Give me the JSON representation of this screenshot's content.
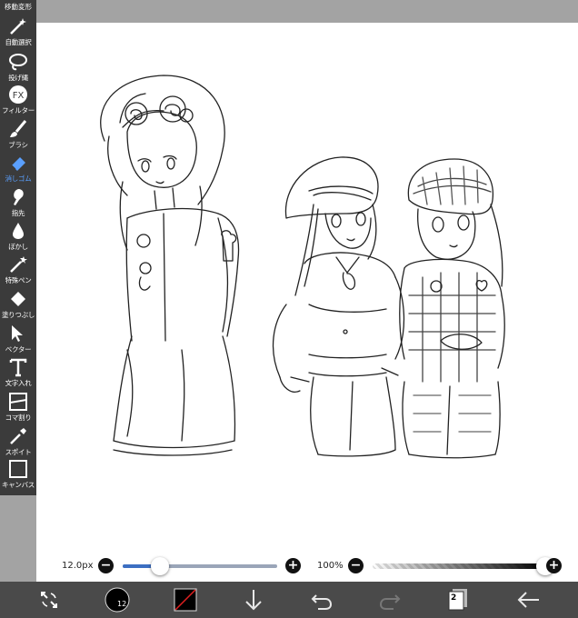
{
  "toolbar": {
    "top_label": "移動変形",
    "tools": [
      {
        "label": "自動選択",
        "icon": "magic-wand-icon"
      },
      {
        "label": "投げ縄",
        "icon": "lasso-icon"
      },
      {
        "label": "フィルター",
        "icon": "fx-filter-icon"
      },
      {
        "label": "ブラシ",
        "icon": "brush-icon"
      },
      {
        "label": "消しゴム",
        "icon": "eraser-icon"
      },
      {
        "label": "指先",
        "icon": "finger-icon"
      },
      {
        "label": "ぼかし",
        "icon": "blur-drop-icon"
      },
      {
        "label": "特殊ペン",
        "icon": "special-pen-icon"
      },
      {
        "label": "塗りつぶし",
        "icon": "fill-bucket-icon"
      },
      {
        "label": "ベクター",
        "icon": "vector-cursor-icon"
      },
      {
        "label": "文字入れ",
        "icon": "text-icon"
      },
      {
        "label": "コマ割り",
        "icon": "frame-divide-icon"
      },
      {
        "label": "スポイト",
        "icon": "eyedropper-icon"
      },
      {
        "label": "キャンバス",
        "icon": "canvas-icon"
      }
    ],
    "active_tool": "消しゴム",
    "active_color": "#5aa0ff"
  },
  "sliders": {
    "brush_size": {
      "label": "12.0px",
      "value_fraction": 0.24,
      "minus": "−",
      "plus": "+"
    },
    "opacity": {
      "label": "100%",
      "value_fraction": 1.0,
      "minus": "−",
      "plus": "+"
    }
  },
  "bottombar": {
    "brush_size_readout": "12",
    "layer_count": "2",
    "icons": [
      "transform-arrows-icon",
      "brush-size-icon",
      "color-swatch-icon",
      "download-arrow-icon",
      "undo-icon",
      "redo-icon",
      "layers-icon",
      "back-arrow-icon"
    ]
  },
  "colors": {
    "toolbar_bg": "#3b3b3b",
    "bottombar_bg": "#4a4a4a",
    "accent": "#3c6fc2",
    "canvas_surround": "#a3a3a3"
  }
}
